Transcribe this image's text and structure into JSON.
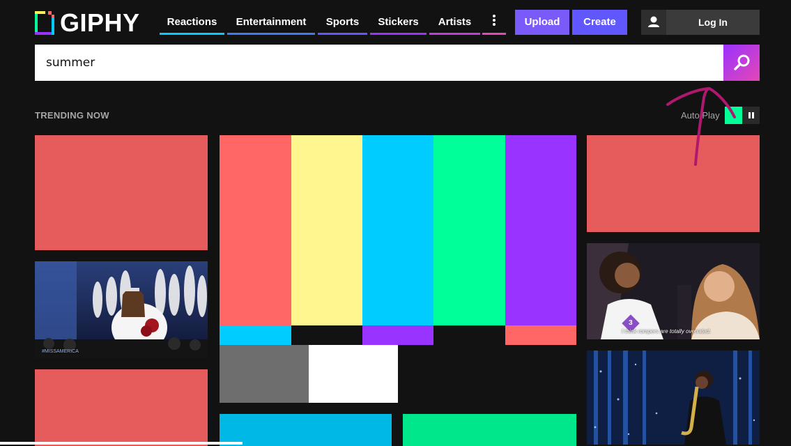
{
  "brand": {
    "name": "GIPHY",
    "icon": "giphy-logo-icon"
  },
  "nav": {
    "items": [
      {
        "label": "Reactions",
        "color": "#00ccff"
      },
      {
        "label": "Entertainment",
        "color": "#3d7bf5"
      },
      {
        "label": "Sports",
        "color": "#6157ff"
      },
      {
        "label": "Stickers",
        "color": "#9933ff"
      },
      {
        "label": "Artists",
        "color": "#c03dd9"
      }
    ],
    "more_icon": "more-vertical-icon",
    "upload_label": "Upload",
    "create_label": "Create",
    "login_label": "Log In",
    "user_icon": "user-icon",
    "upload_color": "#7a5af8",
    "create_color": "#6157ff"
  },
  "search": {
    "value": "summer",
    "icon": "search-icon"
  },
  "trending": {
    "heading": "TRENDING NOW",
    "autoplay_label": "Auto Play",
    "play_icon": "play-icon",
    "pause_icon": "pause-icon"
  },
  "tiles": {
    "pageant_left_caption": "#MISSAMERICA",
    "pageant_right_caption": "I think rompers are totally overrated.",
    "pageant_right_badge": "3",
    "colors": {
      "coral": "#e65c5c",
      "purple_accent": "#9933ff",
      "green_accent": "#00ff99",
      "blue_tile": "#00b8e6",
      "green_tile": "#00e68a"
    },
    "test_pattern": {
      "top_bars": [
        "#ff6666",
        "#fff68f",
        "#00ccff",
        "#00ff99",
        "#9933ff"
      ],
      "mid_bars": [
        "#00ccff",
        "#121212",
        "#9933ff",
        "#121212",
        "#ff6666"
      ],
      "bottom_blocks": [
        "#6e6e6e",
        "#ffffff",
        "#121212",
        "#121212"
      ]
    }
  },
  "annotation": {
    "color": "#b0186e"
  }
}
